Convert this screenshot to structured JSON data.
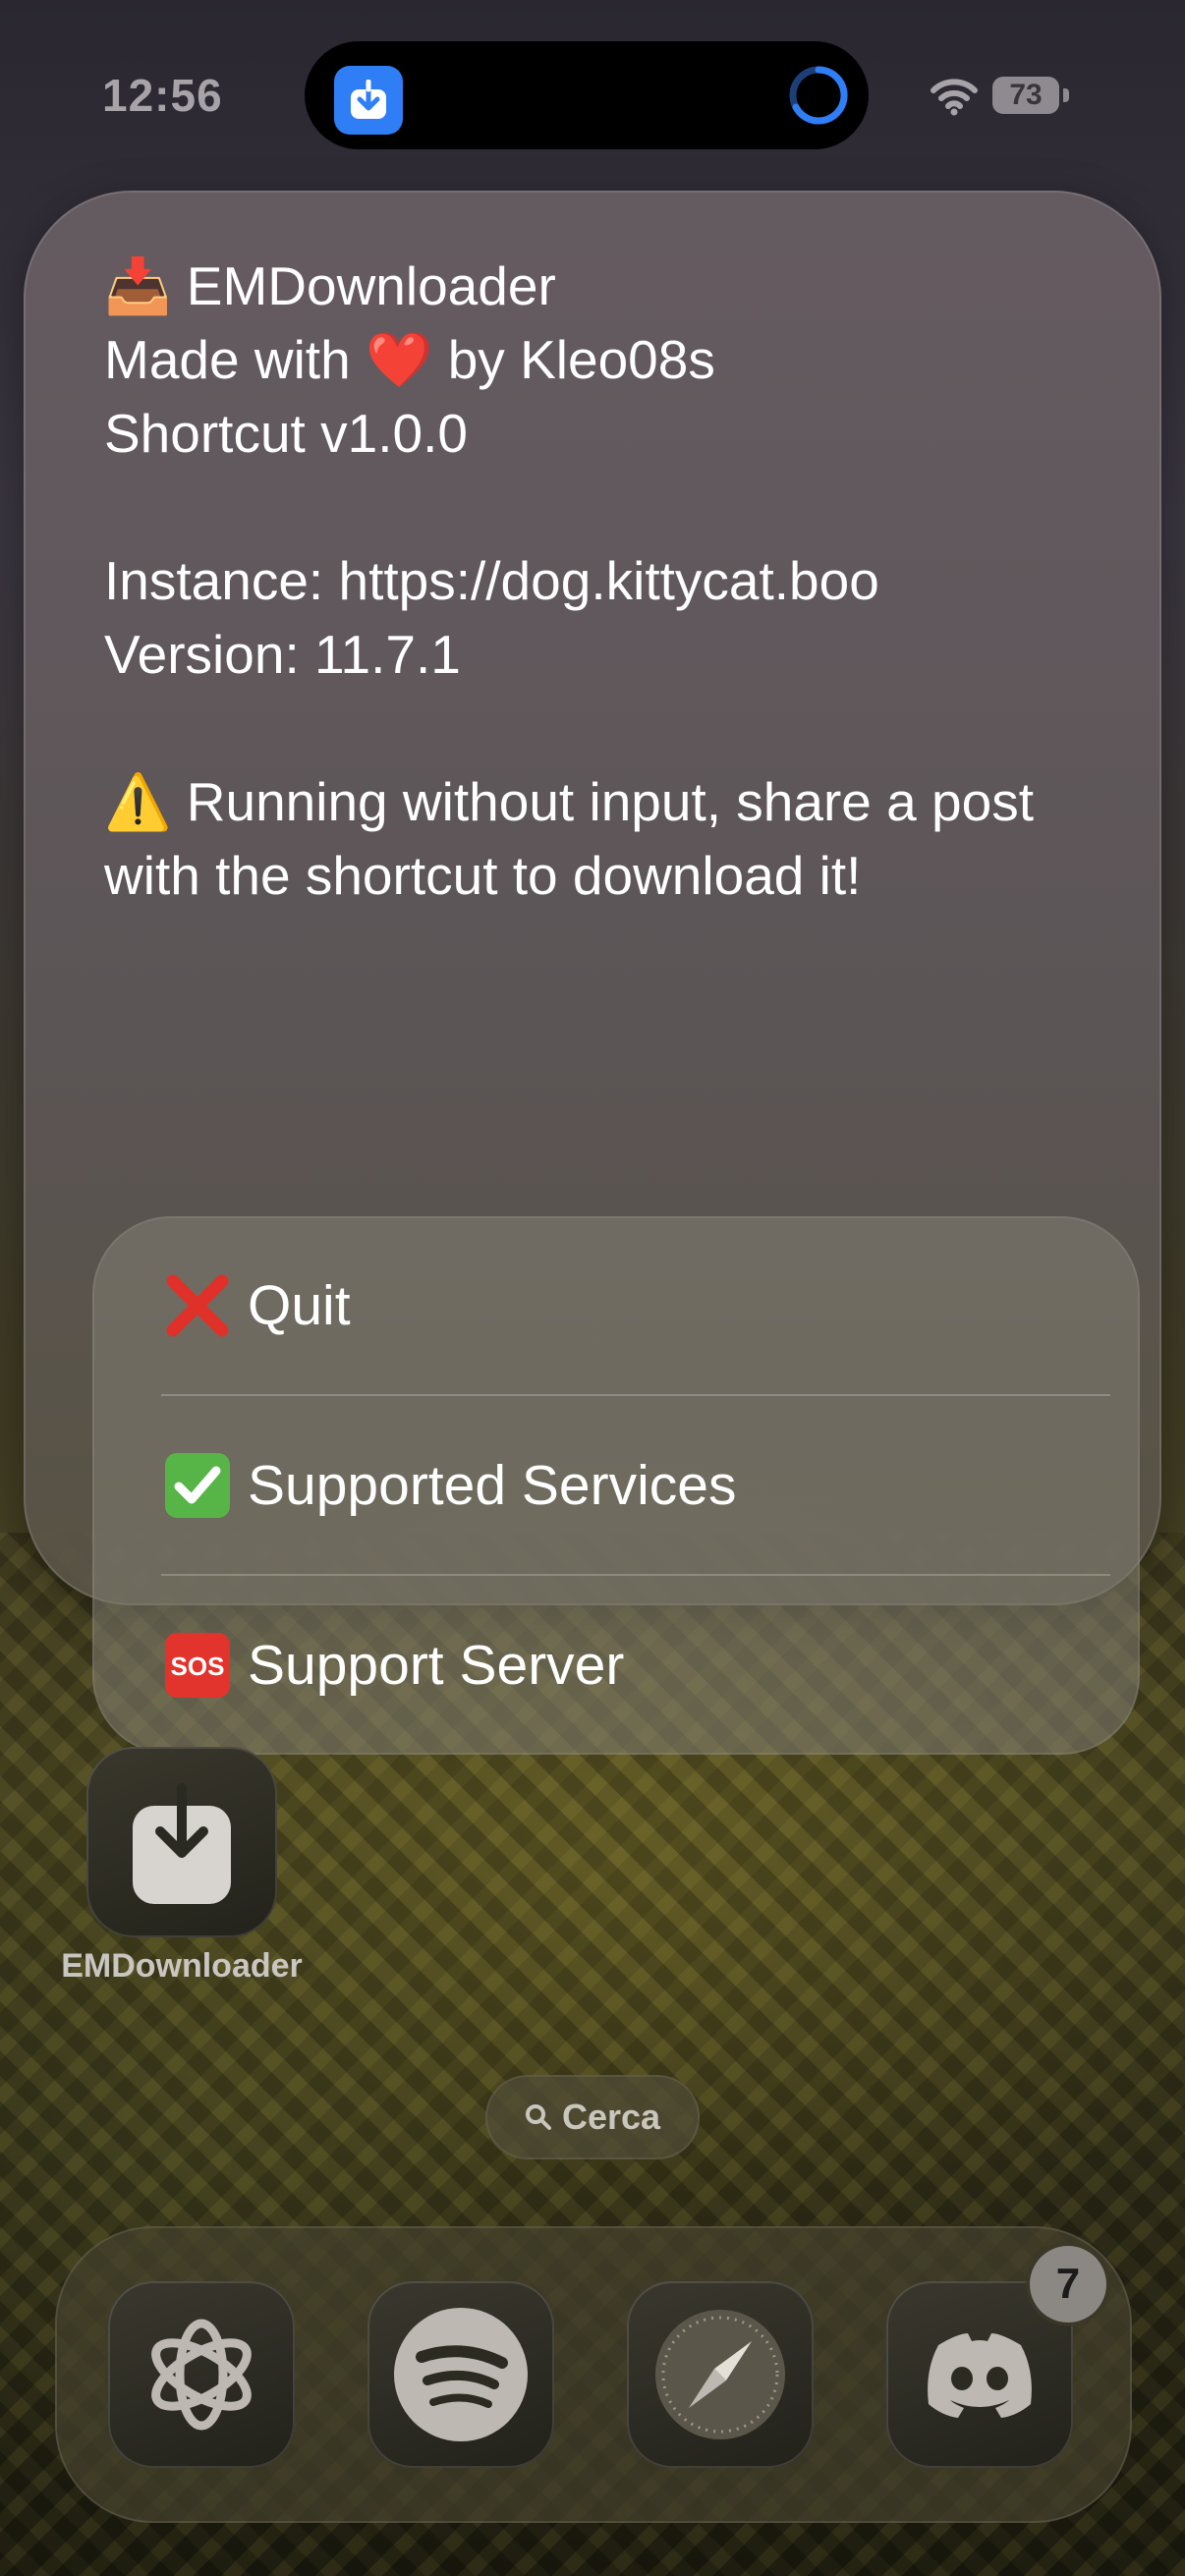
{
  "status_bar": {
    "time": "12:56",
    "battery": "73"
  },
  "alert": {
    "message": "📥 EMDownloader\nMade with ❤️ by Kleo08s\nShortcut v1.0.0\n\nInstance: https://dog.kittycat.boo\nVersion: 11.7.1\n\n⚠️ Running without input, share a post with the shortcut to download it!",
    "options": [
      {
        "label": "Quit",
        "icon": "red-cross-icon"
      },
      {
        "label": "Supported Services",
        "icon": "green-check-icon"
      },
      {
        "label": "Support Server",
        "icon": "sos-icon"
      }
    ]
  },
  "home": {
    "app_label": "EMDownloader",
    "search_label": "Cerca"
  },
  "dock": {
    "apps": [
      "ChatGPT",
      "Spotify",
      "Safari",
      "Discord"
    ],
    "discord_badge": "7"
  },
  "colors": {
    "accent_blue": "#2f7ef6",
    "alert_text": "#ffffff"
  }
}
